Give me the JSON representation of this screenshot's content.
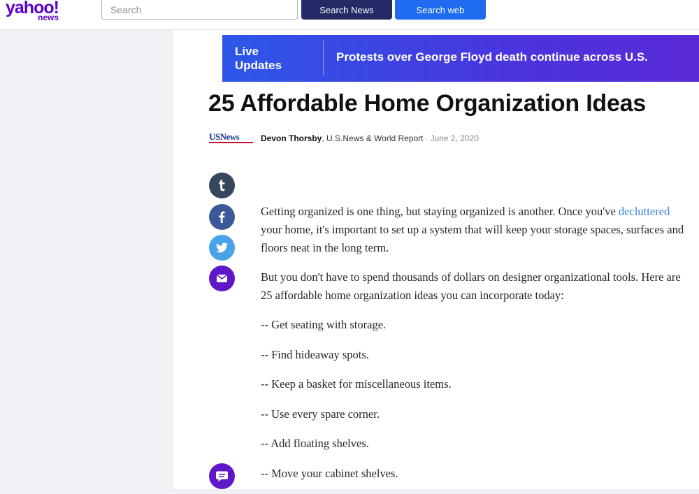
{
  "header": {
    "logo_main": "yahoo!",
    "logo_sub": "news",
    "search_placeholder": "Search",
    "search_news_label": "Search News",
    "search_web_label": "Search web"
  },
  "live_banner": {
    "label": "Live Updates",
    "headline": "Protests over George Floyd death continue across U.S."
  },
  "article": {
    "title": "25 Affordable Home Organization Ideas",
    "source_logo": "USNews",
    "author": "Devon Thorsby",
    "publisher": ", U.S.News & World Report",
    "separator": "·",
    "date": "June 2, 2020",
    "p1_before": "Getting organized is one thing, but staying organized is another. Once you've ",
    "p1_link": "decluttered",
    "p1_after": " your home, it's important to set up a system that will keep your storage spaces, surfaces and floors neat in the long term.",
    "p2": "But you don't have to spend thousands of dollars on designer organizational tools. Here are 25 affordable home organization ideas you can incorporate today:",
    "items": [
      "-- Get seating with storage.",
      "-- Find hideaway spots.",
      "-- Keep a basket for miscellaneous items.",
      "-- Use every spare corner.",
      "-- Add floating shelves.",
      "-- Move your cabinet shelves."
    ]
  },
  "share": {
    "icons": [
      "tumblr-icon",
      "facebook-icon",
      "twitter-icon",
      "mail-icon",
      "comments-icon"
    ]
  },
  "colors": {
    "brand": "#6001d2",
    "search_news_bg": "#232a66",
    "search_web_bg": "#1e6bf0",
    "banner_start": "#2c57e8",
    "banner_end": "#5a2ad6",
    "link": "#3b7fdb"
  }
}
